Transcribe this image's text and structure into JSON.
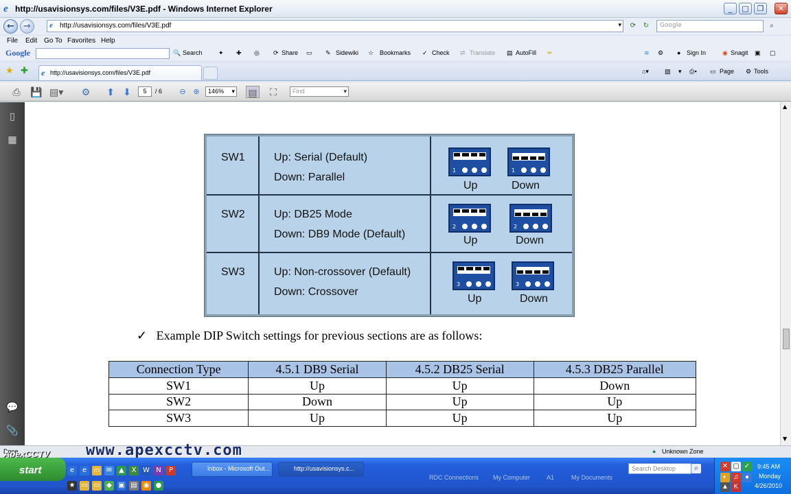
{
  "window": {
    "title": "http://usavisionsys.com/files/V3E.pdf - Windows Internet Explorer",
    "minimize": "_",
    "maximize": "□",
    "close": "✕"
  },
  "address": {
    "url": "http://usavisionsys.com/files/V3E.pdf",
    "search_placeholder": "Google"
  },
  "menu": [
    "File",
    "Edit",
    "Go To",
    "Favorites",
    "Help"
  ],
  "google_toolbar": {
    "logo": "Google",
    "items": [
      "Search",
      "Share",
      "Sidewiki",
      "Bookmarks",
      "Check",
      "Translate",
      "AutoFill"
    ],
    "right_items": [
      "Sign In",
      "Snagit"
    ]
  },
  "tabs": {
    "active": "http://usavisionsys.com/files/V3E.pdf",
    "commands": [
      "Page",
      "Tools"
    ]
  },
  "pdf_toolbar": {
    "page": "5",
    "page_total": "/ 6",
    "zoom": "146%",
    "find_placeholder": "Find"
  },
  "dip_table": {
    "rows": [
      {
        "switch": "SW1",
        "up": "Up: Serial (Default)",
        "down": "Down: Parallel",
        "num": "1"
      },
      {
        "switch": "SW2",
        "up": "Up: DB25 Mode",
        "down": "Down: DB9 Mode (Default)",
        "num": "2"
      },
      {
        "switch": "SW3",
        "up": "Up: Non-crossover (Default)",
        "down": "Down: Crossover",
        "num": "3"
      }
    ],
    "up_label": "Up",
    "down_label": "Down"
  },
  "check_text": "Example DIP Switch settings for previous sections are as follows:",
  "example_table": {
    "headers": [
      "Connection Type",
      "4.5.1 DB9 Serial",
      "4.5.2 DB25 Serial",
      "4.5.3 DB25 Parallel"
    ],
    "rows": [
      [
        "SW1",
        "Up",
        "Up",
        "Down"
      ],
      [
        "SW2",
        "Down",
        "Up",
        "Up"
      ],
      [
        "SW3",
        "Up",
        "Up",
        "Up"
      ]
    ]
  },
  "status": {
    "left": "Done",
    "zone": "Unknown Zone"
  },
  "watermark": {
    "url": "www.apexcctv.com",
    "logo": "ApexCCTV"
  },
  "taskbar": {
    "start": "start",
    "items": [
      "Inbox - Microsoft Out...",
      "http://usavisionsys.c..."
    ],
    "labels": [
      "RDC Connections",
      "My Computer",
      "A1",
      "My Documents"
    ],
    "desktop_search": "Search Desktop",
    "time": "9:45 AM",
    "day": "Monday",
    "date": "4/26/2010"
  }
}
